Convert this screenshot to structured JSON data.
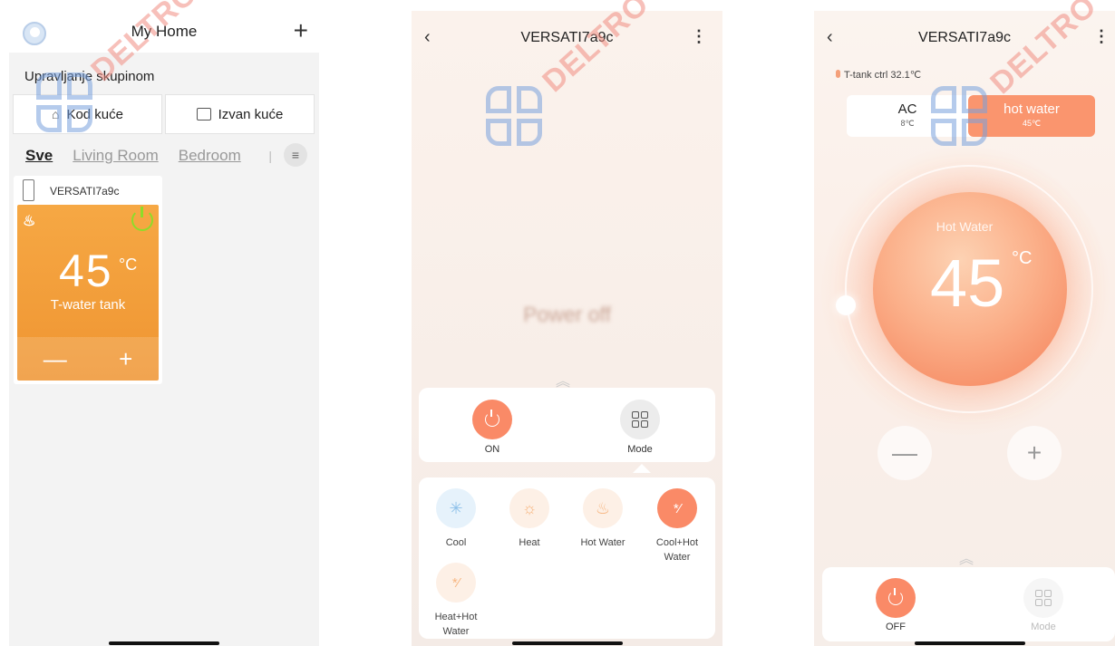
{
  "screen1": {
    "header_title": "My Home",
    "add_icon": "plus-icon",
    "group_label": "Upravljanje skupinom",
    "buttons": [
      {
        "label": "Kod kuće",
        "icon": "home-icon"
      },
      {
        "label": "Izvan kuće",
        "icon": "suitcase-icon"
      }
    ],
    "tabs": [
      {
        "label": "Sve",
        "active": true
      },
      {
        "label": "Living Room",
        "active": false
      },
      {
        "label": "Bedroom",
        "active": false
      }
    ],
    "device": {
      "name": "VERSATI7a9c",
      "temp": "45",
      "unit": "°C",
      "label": "T-water tank",
      "minus": "—",
      "plus": "+",
      "tile_color": "#f29b3a",
      "power_color": "#8edc2a"
    }
  },
  "screen2": {
    "title": "VERSATI7a9c",
    "status": "Power off",
    "power_label": "ON",
    "mode_label": "Mode",
    "modes": [
      {
        "label": "Cool",
        "icon": "snowflake-icon"
      },
      {
        "label": "Heat",
        "icon": "sun-icon"
      },
      {
        "label": "Hot Water",
        "icon": "heat-waves-icon"
      },
      {
        "label": "Cool+Hot Water",
        "icon": "cool-hot-icon"
      },
      {
        "label": "Heat+Hot Water",
        "icon": "heat-hot-icon"
      }
    ],
    "accent": "#fa8a67"
  },
  "screen3": {
    "title": "VERSATI7a9c",
    "ttank": "T-tank ctrl 32.1℃",
    "seg_a_label": "AC",
    "seg_a_value": "8℃",
    "seg_b_label": "hot water",
    "seg_b_value": "45℃",
    "dial_label": "Hot Water",
    "dial_value": "45",
    "dial_unit": "°C",
    "minus": "—",
    "plus": "+",
    "power_label": "OFF",
    "mode_label": "Mode"
  },
  "watermark": {
    "text": "DELTRO"
  }
}
